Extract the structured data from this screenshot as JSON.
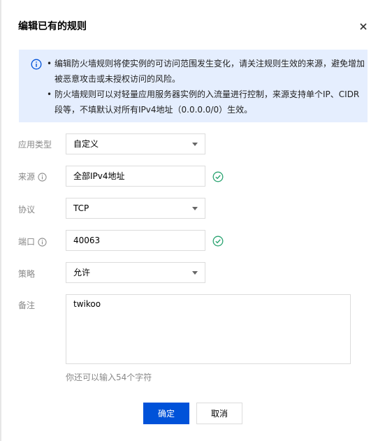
{
  "dialog": {
    "title": "编辑已有的规则"
  },
  "notice": {
    "items": [
      "编辑防火墙规则将使实例的可访问范围发生变化，请关注规则生效的来源，避免增加被恶意攻击或未授权访问的风险。",
      "防火墙规则可以对轻量应用服务器实例的入流量进行控制，来源支持单个IP、CIDR段等，不填默认对所有IPv4地址（0.0.0.0/0）生效。"
    ],
    "bullet": "•"
  },
  "form": {
    "app_type": {
      "label": "应用类型",
      "value": "自定义"
    },
    "source": {
      "label": "来源",
      "value": "全部IPv4地址"
    },
    "protocol": {
      "label": "协议",
      "value": "TCP"
    },
    "port": {
      "label": "端口",
      "value": "40063"
    },
    "policy": {
      "label": "策略",
      "value": "允许"
    },
    "remark": {
      "label": "备注",
      "value": "twikoo",
      "hint": "你还可以输入54个字符"
    }
  },
  "buttons": {
    "confirm": "确定",
    "cancel": "取消"
  },
  "colors": {
    "primary": "#0052d9",
    "notice_bg": "#e5eefe",
    "success": "#2ba471"
  },
  "icons": [
    "info-icon",
    "close-icon",
    "help-icon",
    "check-circle-icon",
    "chevron-down-icon"
  ]
}
